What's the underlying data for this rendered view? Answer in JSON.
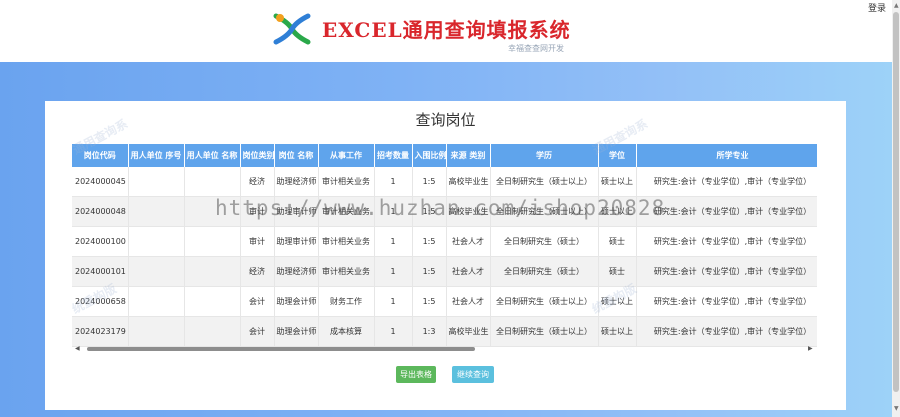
{
  "header": {
    "title": "EXCEL通用查询填报系统",
    "subtitle": "幸福查查网开发",
    "login": "登录"
  },
  "panel": {
    "title": "查询岗位"
  },
  "table": {
    "columns": [
      "岗位代码",
      "用人单位 序号",
      "用人单位 名称",
      "岗位类别",
      "岗位 名称",
      "从事工作",
      "招考数量",
      "入围比例",
      "来源 类别",
      "学历",
      "学位",
      "所学专业"
    ],
    "rows": [
      [
        "2024000045",
        "",
        "",
        "经济",
        "助理经济师",
        "审计相关业务",
        "1",
        "1:5",
        "高校毕业生",
        "全日制研究生（硕士以上）",
        "硕士以上",
        "研究生:会计（专业学位）,审计（专业学位）"
      ],
      [
        "2024000048",
        "",
        "",
        "审计",
        "助理审计师",
        "审计相关业务",
        "1",
        "1:5",
        "高校毕业生",
        "全日制研究生（硕士以上）",
        "硕士以上",
        "研究生:会计（专业学位）,审计（专业学位）"
      ],
      [
        "2024000100",
        "",
        "",
        "审计",
        "助理审计师",
        "审计相关业务",
        "1",
        "1:5",
        "社会人才",
        "全日制研究生（硕士）",
        "硕士",
        "研究生:会计（专业学位）,审计（专业学位）"
      ],
      [
        "2024000101",
        "",
        "",
        "经济",
        "助理经济师",
        "审计相关业务",
        "1",
        "1:5",
        "社会人才",
        "全日制研究生（硕士）",
        "硕士",
        "研究生:会计（专业学位）,审计（专业学位）"
      ],
      [
        "2024000658",
        "",
        "",
        "会计",
        "助理会计师",
        "财务工作",
        "1",
        "1:5",
        "社会人才",
        "全日制研究生（硕士以上）",
        "硕士以上",
        "研究生:会计（专业学位）,审计（专业学位）"
      ],
      [
        "2024023179",
        "",
        "",
        "会计",
        "助理会计师",
        "成本核算",
        "1",
        "1:3",
        "高校毕业生",
        "全日制研究生（硕士以上）",
        "硕士以上",
        "研究生:会计（专业学位）,审计（专业学位）"
      ]
    ]
  },
  "buttons": {
    "export": "导出表格",
    "continue": "继续查询"
  },
  "watermark": {
    "url": "https://www.huzhan.com/ishop20828",
    "text_a": "通用查询系",
    "text_b": "统重构版"
  },
  "colors": {
    "header_accent": "#d9262c",
    "table_header": "#5fa4ec",
    "export_button": "#5cb85c",
    "continue_button": "#5bc0de"
  }
}
